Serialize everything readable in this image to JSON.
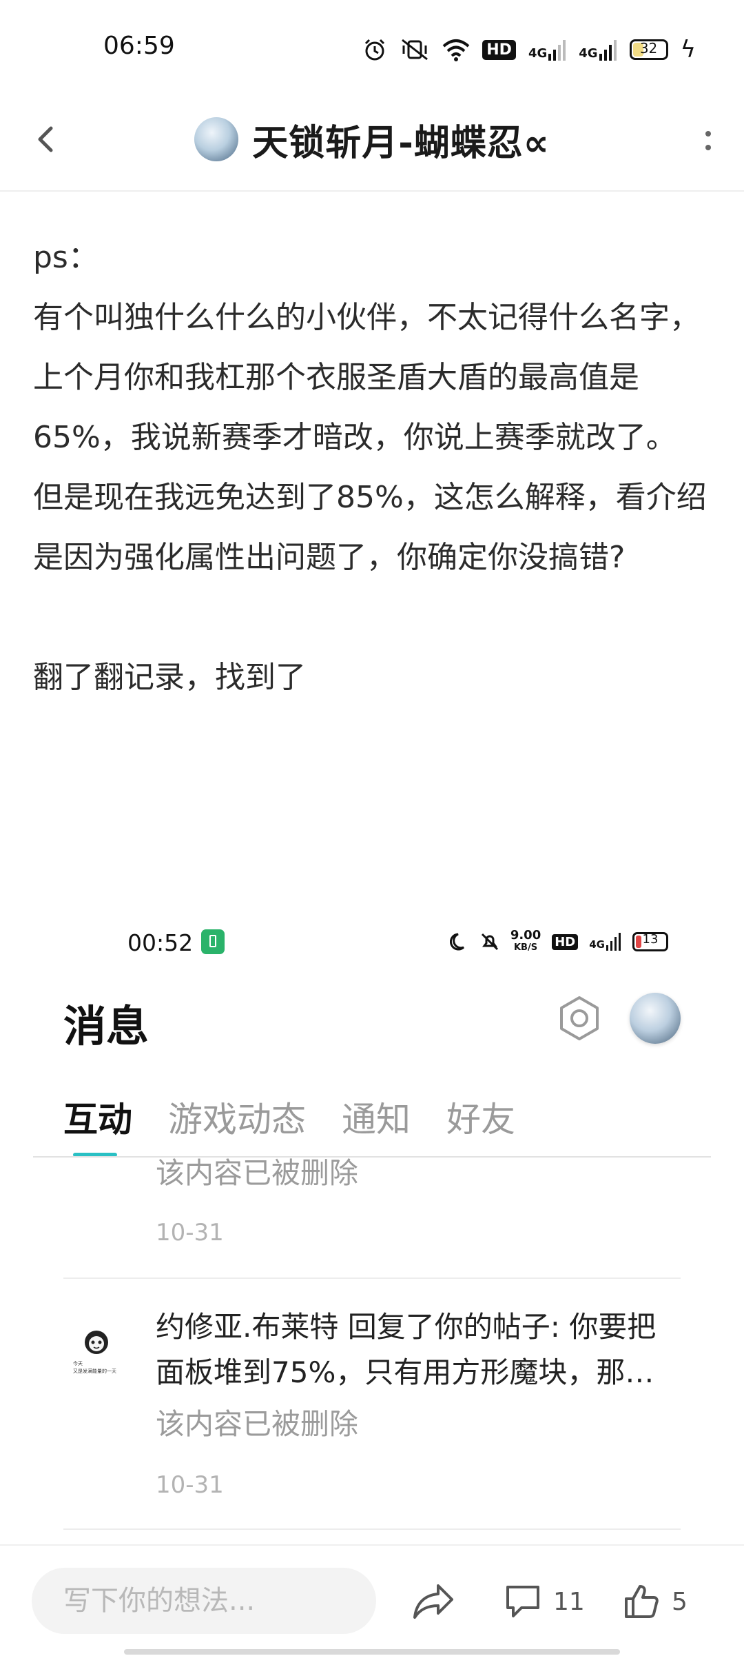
{
  "status_bar": {
    "time": "06:59",
    "hd": "HD",
    "network_1": "4G",
    "network_2": "4G",
    "battery": "32"
  },
  "header": {
    "title": "天锁斩月-蝴蝶忍∝",
    "back_icon": "chevron-left-icon",
    "more_icon": "more-vertical-icon"
  },
  "post": {
    "paragraphs": [
      "ps：",
      "有个叫独什么什么的小伙伴，不太记得什么名字，",
      "上个月你和我杠那个衣服圣盾大盾的最高值是65%，我说新赛季才暗改，你说上赛季就改了。",
      "但是现在我远免达到了85%，这怎么解释，看介绍是因为强化属性出问题了，你确定你没搞错?",
      "翻了翻记录，找到了"
    ]
  },
  "embedded": {
    "status_time": "00:52",
    "speed": "9.00",
    "speed_unit": "KB/S",
    "hd": "HD",
    "network": "4G",
    "battery": "13",
    "title": "消息",
    "tabs": [
      "互动",
      "游戏动态",
      "通知",
      "好友"
    ],
    "active_tab": "互动",
    "messages": [
      {
        "deleted": "该内容已被删除",
        "date": "10-31"
      },
      {
        "line1": "约修亚.布莱特 回复了你的帖子: 你要把",
        "line2": "面板堆到75%，只有用方形魔块，那…",
        "avatar_caption_1": "今天",
        "avatar_caption_2": "又是发满能量的一天",
        "deleted": "该内容已被删除",
        "date": "10-31"
      }
    ]
  },
  "bottom_bar": {
    "input_placeholder": "写下你的想法...",
    "comment_count": "11",
    "like_count": "5"
  },
  "colors": {
    "accent": "#2ac0c4",
    "muted_text": "#9b9b9b",
    "battery_low": "#e04545"
  }
}
